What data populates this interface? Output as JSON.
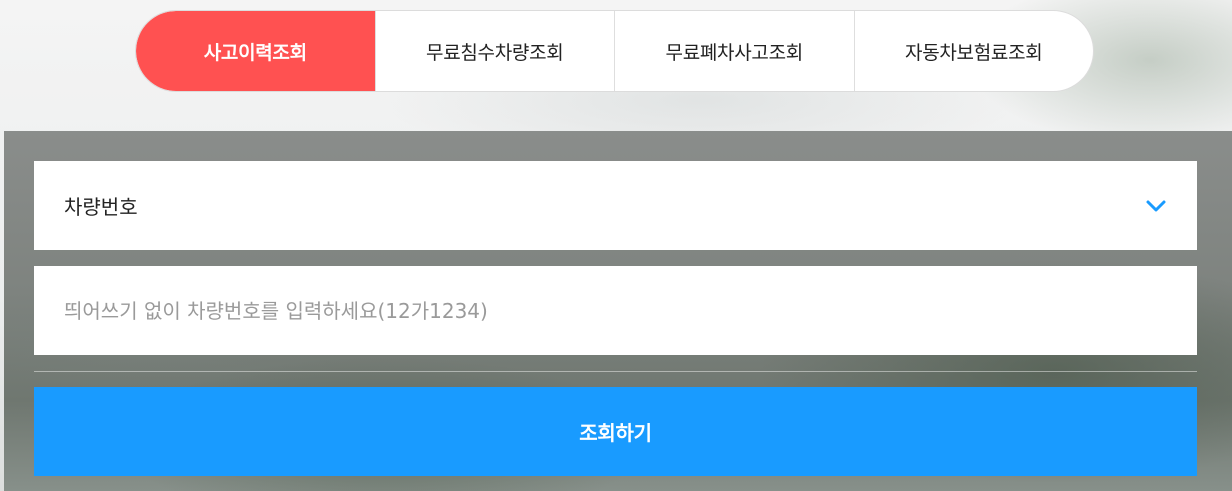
{
  "tabs": [
    {
      "label": "사고이력조회",
      "active": true
    },
    {
      "label": "무료침수차량조회",
      "active": false
    },
    {
      "label": "무료폐차사고조회",
      "active": false
    },
    {
      "label": "자동차보험료조회",
      "active": false
    }
  ],
  "form": {
    "select": {
      "selected": "차량번호",
      "icon": "chevron-down-icon"
    },
    "input": {
      "value": "",
      "placeholder": "띄어쓰기 없이 차량번호를 입력하세요(12가1234)"
    },
    "submit_label": "조회하기"
  },
  "colors": {
    "active_tab": "#ff5151",
    "submit_button": "#199bff",
    "chevron": "#199bff"
  }
}
